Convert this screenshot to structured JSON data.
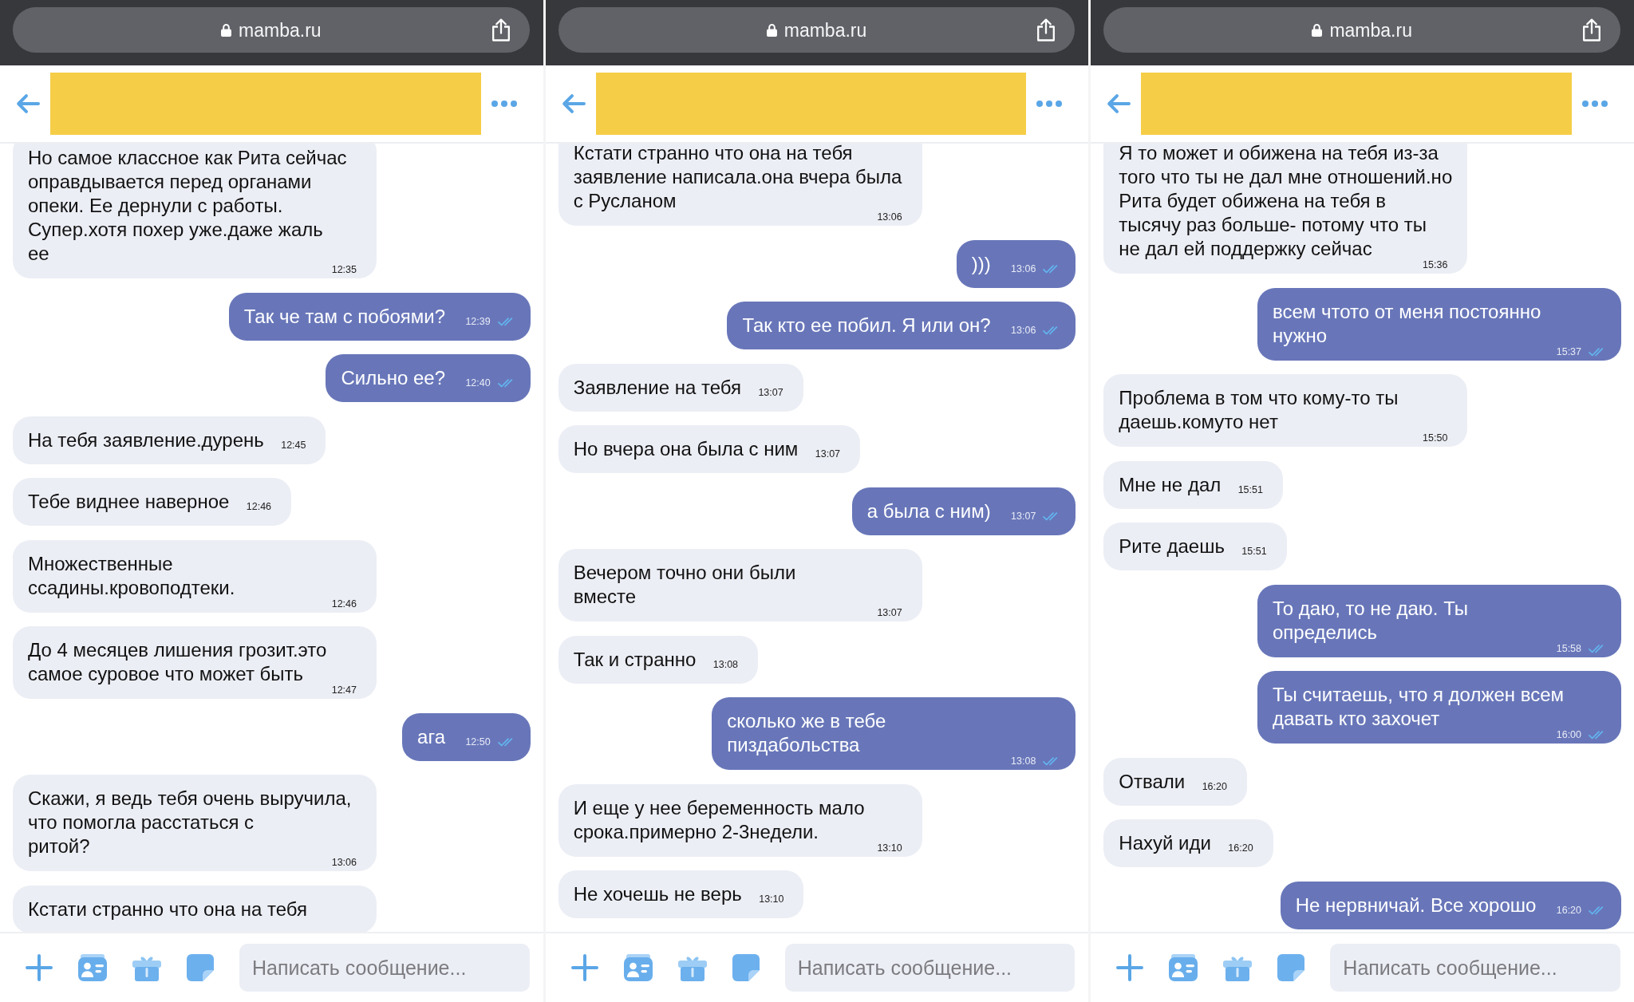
{
  "panels": [
    {
      "browser": {
        "url": "mamba.ru"
      },
      "messages": [
        {
          "kind": "incoming",
          "text": "Но самое классное как Рита сейчас оправдывается перед органами опеки. Ее дернули с работы. Супер.хотя похер уже.даже жаль ее",
          "time": "12:35"
        },
        {
          "kind": "outgoing",
          "text": "Так че там с побоями?",
          "time": "12:39",
          "read": true
        },
        {
          "kind": "outgoing",
          "text": "Сильно ее?",
          "time": "12:40",
          "read": true
        },
        {
          "kind": "incoming",
          "text": "На тебя заявление.дурень",
          "time": "12:45"
        },
        {
          "kind": "incoming",
          "text": "Тебе виднее наверное",
          "time": "12:46"
        },
        {
          "kind": "incoming",
          "text": "Множественные ссадины.кровоподтеки.",
          "time": "12:46"
        },
        {
          "kind": "incoming",
          "text": "До 4 месяцев лишения грозит.это самое суровое что может быть",
          "time": "12:47"
        },
        {
          "kind": "outgoing",
          "text": "ага",
          "time": "12:50",
          "read": true
        },
        {
          "kind": "incoming",
          "text": "Скажи, я ведь тебя очень выручила, что помогла расстаться с ритой?",
          "time": "13:06"
        },
        {
          "kind": "incoming",
          "text": "Кстати странно что она на тебя"
        }
      ],
      "composer": {
        "placeholder": "Написать сообщение..."
      }
    },
    {
      "browser": {
        "url": "mamba.ru"
      },
      "messages": [
        {
          "kind": "incoming",
          "text": "Кстати странно что она на тебя заявление написала.она вчера была с Русланом",
          "time": "13:06"
        },
        {
          "kind": "outgoing",
          "text": ")))",
          "time": "13:06",
          "read": true
        },
        {
          "kind": "outgoing",
          "text": "Так кто ее побил. Я или он?",
          "time": "13:06",
          "read": true
        },
        {
          "kind": "incoming",
          "text": "Заявление на тебя",
          "time": "13:07"
        },
        {
          "kind": "incoming",
          "text": "Но вчера она была с ним",
          "time": "13:07"
        },
        {
          "kind": "outgoing",
          "text": "а была с ним)",
          "time": "13:07",
          "read": true
        },
        {
          "kind": "incoming",
          "text": "Вечером точно они были вместе",
          "time": "13:07"
        },
        {
          "kind": "incoming",
          "text": "Так и странно",
          "time": "13:08"
        },
        {
          "kind": "outgoing",
          "text": "сколько же в тебе пиздабольства",
          "time": "13:08",
          "read": true
        },
        {
          "kind": "incoming",
          "text": "И еще у нее беременность мало срока.примерно 2-3недели.",
          "time": "13:10"
        },
        {
          "kind": "incoming",
          "text": "Не хочешь не верь",
          "time": "13:10"
        }
      ],
      "composer": {
        "placeholder": "Написать сообщение..."
      }
    },
    {
      "browser": {
        "url": "mamba.ru"
      },
      "messages": [
        {
          "kind": "incoming",
          "text": "Я то может и обижена на тебя из-за того что ты не дал мне отношений.но Рита будет обижена на тебя в тысячу раз больше- потому что ты не дал ей поддержку сейчас",
          "time": "15:36"
        },
        {
          "kind": "outgoing",
          "text": "всем чтото от меня постоянно нужно",
          "time": "15:37",
          "read": true
        },
        {
          "kind": "incoming",
          "text": "Проблема в том что кому-то ты даешь.комуто нет",
          "time": "15:50"
        },
        {
          "kind": "incoming",
          "text": "Мне не дал",
          "time": "15:51"
        },
        {
          "kind": "incoming",
          "text": "Рите даешь",
          "time": "15:51"
        },
        {
          "kind": "outgoing",
          "text": "То даю, то не даю. Ты определись",
          "time": "15:58",
          "read": true
        },
        {
          "kind": "outgoing",
          "text": "Ты считаешь, что я должен всем давать кто захочет",
          "time": "16:00",
          "read": true
        },
        {
          "kind": "incoming",
          "text": "Отвали",
          "time": "16:20"
        },
        {
          "kind": "incoming",
          "text": "Нахуй иди",
          "time": "16:20"
        },
        {
          "kind": "outgoing",
          "text": "Не нервничай. Все хорошо",
          "time": "16:20",
          "read": true
        }
      ],
      "composer": {
        "placeholder": "Написать сообщение..."
      }
    }
  ]
}
